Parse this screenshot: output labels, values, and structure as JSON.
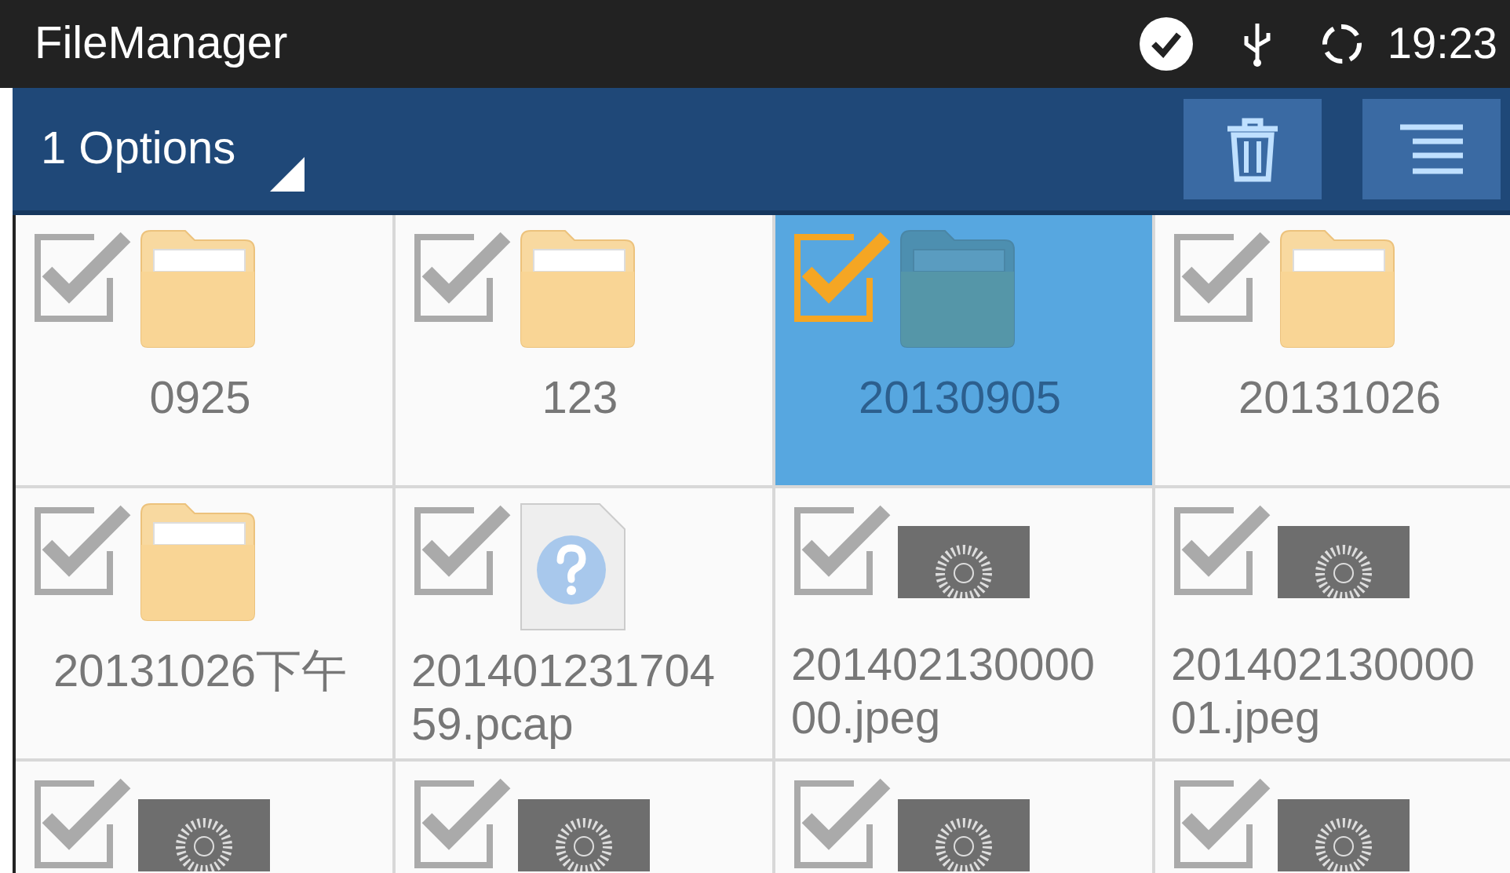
{
  "status_bar": {
    "app_title": "FileManager",
    "time": "19:23"
  },
  "action_bar": {
    "options_label": "1 Options"
  },
  "files": [
    {
      "kind": "folder",
      "name": "0925",
      "selected": false
    },
    {
      "kind": "folder",
      "name": "123",
      "selected": false
    },
    {
      "kind": "folder",
      "name": "20130905",
      "selected": true
    },
    {
      "kind": "folder",
      "name": "20131026",
      "selected": false
    },
    {
      "kind": "folder",
      "name": "20131026下午",
      "selected": false
    },
    {
      "kind": "unknown",
      "name": "20140123170459.pcap",
      "selected": false
    },
    {
      "kind": "image",
      "name": "20140213000000.jpeg",
      "selected": false
    },
    {
      "kind": "image",
      "name": "20140213000001.jpeg",
      "selected": false
    },
    {
      "kind": "image",
      "selected": false
    },
    {
      "kind": "image",
      "selected": false
    },
    {
      "kind": "image",
      "selected": false
    },
    {
      "kind": "image",
      "selected": false
    }
  ]
}
